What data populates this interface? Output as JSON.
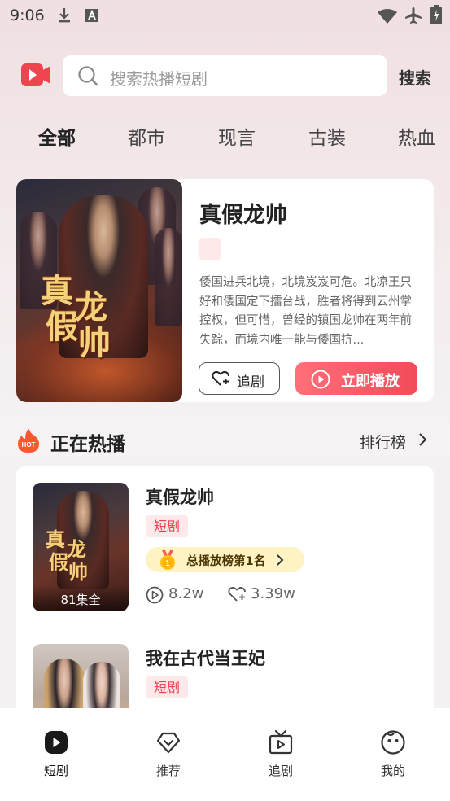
{
  "status_bar": {
    "time": "9:06"
  },
  "search": {
    "placeholder": "搜索热播短剧",
    "button_label": "搜索"
  },
  "categories": [
    "全部",
    "都市",
    "现言",
    "古装",
    "热血"
  ],
  "featured": {
    "title": "真假龙帅",
    "poster_title_chars": [
      "真",
      "假",
      "龙",
      "帅"
    ],
    "description": "倭国进兵北境，北境岌岌可危。北凉王只好和倭国定下擂台战，胜者将得到云州掌控权，但可惜，曾经的镇国龙帅在两年前失踪，而境内唯一能与倭国抗...",
    "follow_label": "追剧",
    "play_label": "立即播放"
  },
  "hot_section": {
    "title": "正在热播",
    "ranking_link": "排行榜",
    "items": [
      {
        "title": "真假龙帅",
        "tag": "短剧",
        "episode_count": "81集全",
        "rank_badge": "总播放榜第1名",
        "medal_number": "1",
        "plays": "8.2w",
        "follows": "3.39w"
      },
      {
        "title": "我在古代当王妃",
        "tag": "短剧"
      }
    ]
  },
  "bottom_nav": [
    {
      "label": "短剧",
      "icon": "play-circle-icon",
      "active": true
    },
    {
      "label": "推荐",
      "icon": "heart-diamond-icon",
      "active": false
    },
    {
      "label": "追剧",
      "icon": "tv-icon",
      "active": false
    },
    {
      "label": "我的",
      "icon": "face-icon",
      "active": false
    }
  ],
  "colors": {
    "accent": "#f24b5a",
    "tag_bg": "#fde8ea",
    "tag_text": "#e9414f",
    "rank_badge_bg": "#fff3c4",
    "logo": "#f0454f"
  }
}
